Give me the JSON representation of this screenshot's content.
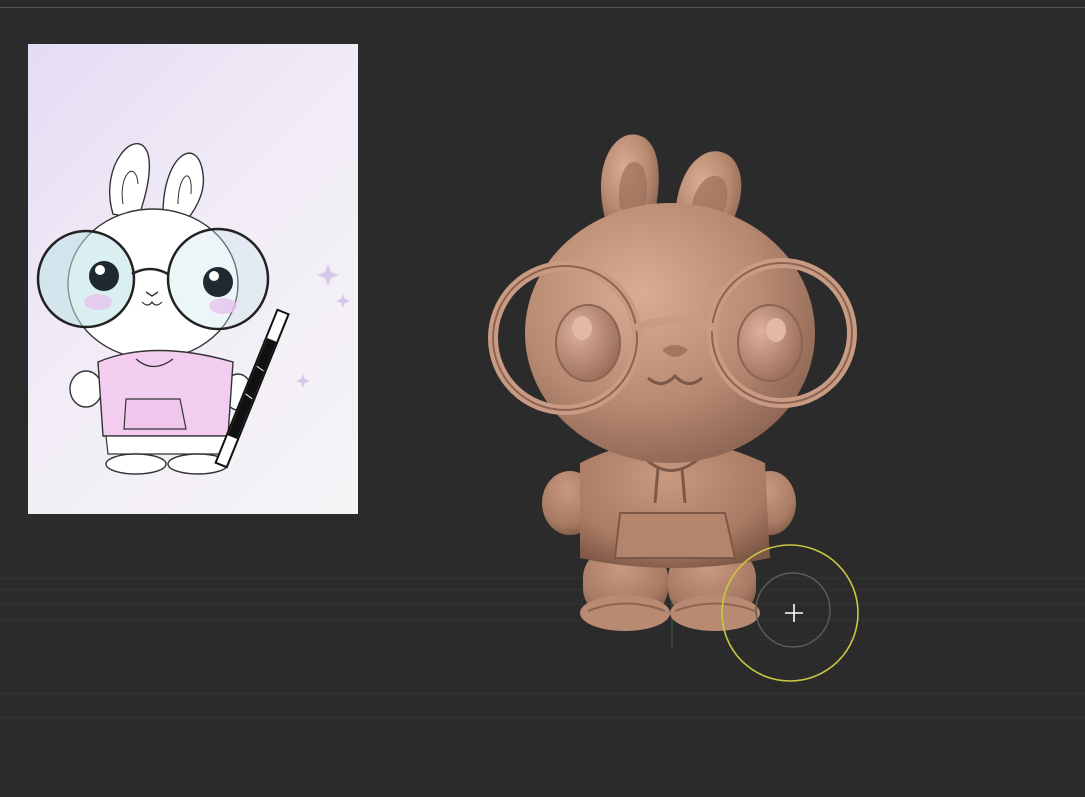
{
  "app": {
    "mode": "sculpt-viewport"
  },
  "reference_image": {
    "subject": "bunny-sketch-with-glasses-hoodie-and-pencil",
    "colors": {
      "hoodie": "#f3cdf0",
      "background": "#ece6f4",
      "cheeks": "#e6c3ee"
    }
  },
  "model": {
    "subject": "bunny-3d-sculpt",
    "colors": {
      "clay": "#b88a72",
      "clay_shadow": "#8c6452",
      "clay_highlight": "#d9ac94"
    }
  },
  "brush_cursor": {
    "outer_color": "#c9c742",
    "inner_color": "#5b5f52"
  },
  "colors": {
    "background": "#2b2b2b",
    "grid": "#3a3a3a",
    "top_line": "#565656"
  }
}
